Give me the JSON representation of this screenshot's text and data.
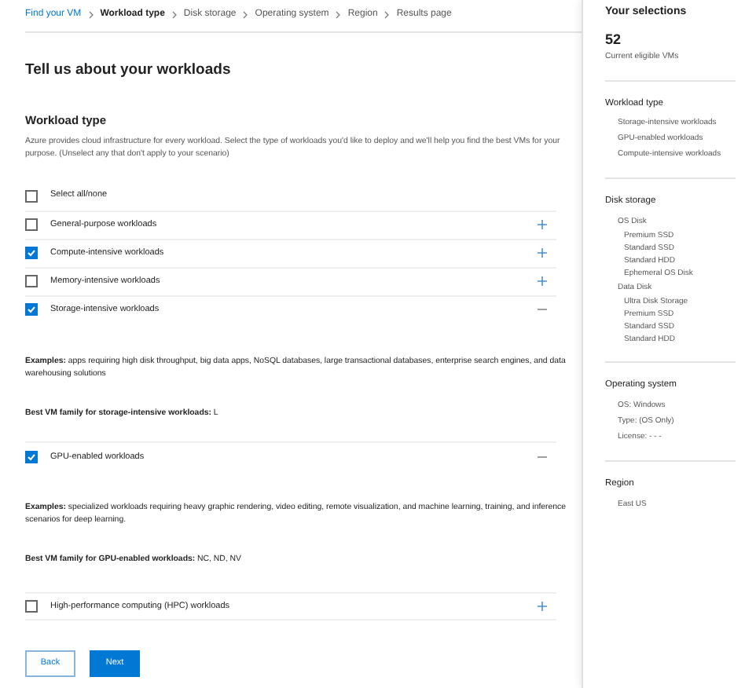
{
  "breadcrumb": [
    {
      "label": "Find your VM",
      "selected": false,
      "kind": "link"
    },
    {
      "label": "Workload type",
      "selected": true,
      "kind": "current"
    },
    {
      "label": "Disk storage",
      "selected": false,
      "kind": "step"
    },
    {
      "label": "Operating system",
      "selected": false,
      "kind": "step"
    },
    {
      "label": "Region",
      "selected": false,
      "kind": "step"
    },
    {
      "label": "Results page",
      "selected": false,
      "kind": "step"
    }
  ],
  "page_title": "Tell us about your workloads",
  "section": {
    "title": "Workload type",
    "description": "Azure provides cloud infrastructure for every workload. Select the type of workloads you'd like to deploy and we'll help you find the best VMs for your purpose. (Unselect any that don't apply to your scenario)"
  },
  "select_all": {
    "label": "Select all/none",
    "checked": false
  },
  "workloads": [
    {
      "label": "General-purpose workloads",
      "checked": false,
      "expanded": false
    },
    {
      "label": "Compute-intensive workloads",
      "checked": true,
      "expanded": false
    },
    {
      "label": "Memory-intensive workloads",
      "checked": false,
      "expanded": false
    },
    {
      "label": "Storage-intensive workloads",
      "checked": true,
      "expanded": true,
      "examples": "**Examples:** apps requiring high disk throughput, big data apps, NoSQL databases, large transactional databases, enterprise search engines, and data warehousing solutions",
      "best_family": "**Best VM family for storage-intensive workloads:** L"
    },
    {
      "label": "GPU-enabled workloads",
      "checked": true,
      "expanded": true,
      "examples": "**Examples:** specialized workloads requiring heavy graphic rendering, video editing, remote visualization, and machine learning, training, and inference scenarios for deep learning.",
      "best_family": "**Best VM family for GPU-enabled workloads:** NC, ND, NV"
    },
    {
      "label": "High-performance computing (HPC) workloads",
      "checked": false,
      "expanded": false
    }
  ],
  "buttons": [
    {
      "label": "Back",
      "kind": "secondary"
    },
    {
      "label": "Next",
      "kind": "primary"
    }
  ],
  "sidebar": {
    "title": "Your selections",
    "count": "52",
    "count_label": "Current eligible VMs",
    "groups": [
      {
        "title": "Workload type",
        "items": [
          {
            "label": "Storage-intensive workloads"
          },
          {
            "label": "GPU-enabled workloads"
          },
          {
            "label": "Compute-intensive workloads"
          }
        ]
      },
      {
        "title": "Disk storage",
        "items": [
          {
            "label": "OS Disk",
            "children": [
              {
                "label": "Premium SSD"
              },
              {
                "label": "Standard SSD"
              },
              {
                "label": "Standard HDD"
              },
              {
                "label": "Ephemeral OS Disk"
              }
            ]
          },
          {
            "label": "Data Disk",
            "children": [
              {
                "label": "Ultra Disk Storage"
              },
              {
                "label": "Premium SSD"
              },
              {
                "label": "Standard SSD"
              },
              {
                "label": "Standard HDD"
              }
            ]
          }
        ]
      },
      {
        "title": "Operating system",
        "items": [
          {
            "label": "OS: Windows"
          },
          {
            "label": "Type: (OS Only)"
          },
          {
            "label": "License: - - -"
          }
        ]
      },
      {
        "title": "Region",
        "items": [
          {
            "label": "East US"
          }
        ]
      }
    ]
  }
}
